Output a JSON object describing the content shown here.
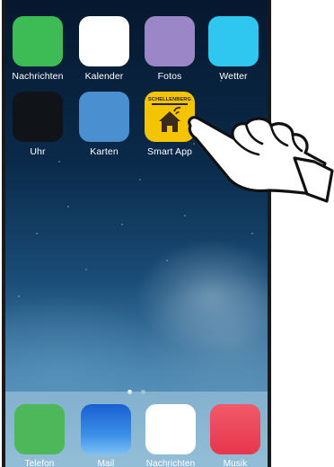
{
  "home_screen": {
    "apps": [
      {
        "label": "Nachrichten",
        "color": "#3dbb55"
      },
      {
        "label": "Kalender",
        "color": "#ffffff"
      },
      {
        "label": "Fotos",
        "color": "#9b86c8"
      },
      {
        "label": "Wetter",
        "color": "#2fc6f0"
      },
      {
        "label": "Uhr",
        "color": "#101418"
      },
      {
        "label": "Karten",
        "color": "#4a8fd0"
      },
      {
        "label": "Smart App",
        "color": "#f5c400",
        "brand": "SCHELLENBERG"
      }
    ]
  },
  "page_indicator": {
    "pages": 2,
    "current": 1
  },
  "dock": {
    "apps": [
      {
        "label": "Telefon",
        "color": "#4cb85a"
      },
      {
        "label": "Mail",
        "color": "#3a7fe0"
      },
      {
        "label": "Nachrichten",
        "color": "#ffffff"
      },
      {
        "label": "Musik",
        "color": "#f2455a"
      }
    ]
  },
  "overlay": {
    "hand_icon": "pointing-hand-icon"
  }
}
